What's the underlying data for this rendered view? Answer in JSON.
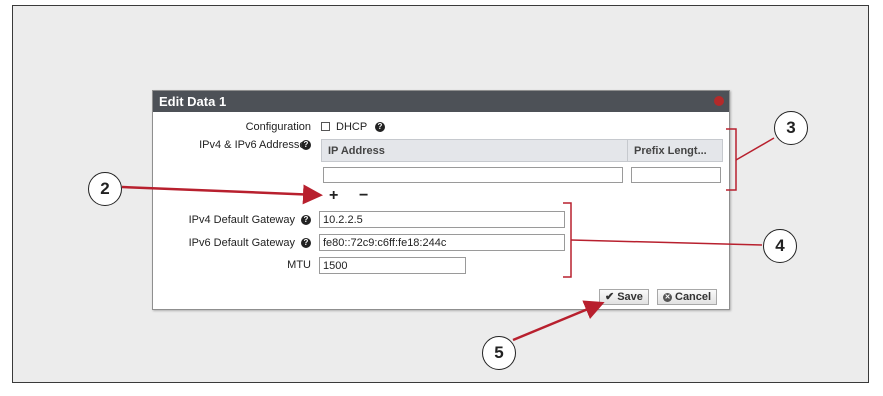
{
  "dialog": {
    "title": "Edit Data 1",
    "configuration_label": "Configuration",
    "dhcp_label": "DHCP",
    "dhcp_checked": false,
    "addresses_label": "IPv4 & IPv6 Addresses",
    "table": {
      "columns": [
        "IP Address",
        "Prefix Lengt..."
      ],
      "row": {
        "ip_address": "",
        "prefix_length": ""
      }
    },
    "add_symbol": "+",
    "remove_symbol": "−",
    "ipv4_gateway_label": "IPv4 Default Gateway",
    "ipv4_gateway_value": "10.2.2.5",
    "ipv6_gateway_label": "IPv6 Default Gateway",
    "ipv6_gateway_value": "fe80::72c9:c6ff:fe18:244c",
    "mtu_label": "MTU",
    "mtu_value": "1500",
    "save_label": "Save",
    "cancel_label": "Cancel"
  },
  "callouts": [
    "2",
    "3",
    "4",
    "5"
  ],
  "colors": {
    "title_bar": "#4d5157",
    "callout_line": "#b8202e",
    "close_button": "#b42a2a"
  }
}
